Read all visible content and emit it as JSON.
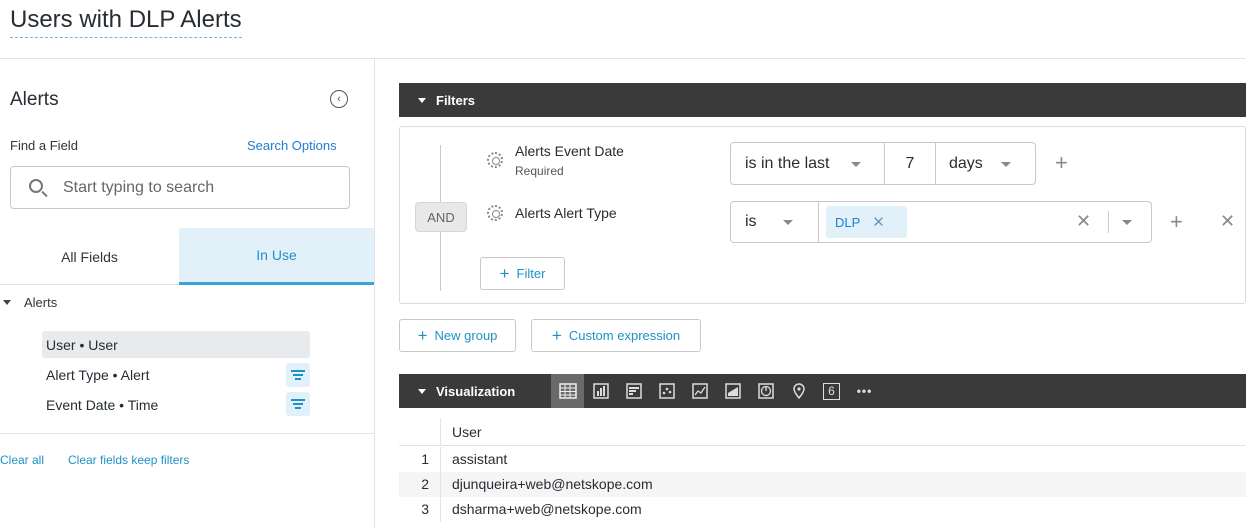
{
  "header": {
    "title": "Users with DLP Alerts"
  },
  "sidebar": {
    "title": "Alerts",
    "find_label": "Find a Field",
    "search_options": "Search Options",
    "search_placeholder": "Start typing to search",
    "tabs": [
      {
        "label": "All Fields"
      },
      {
        "label": "In Use"
      }
    ],
    "group": "Alerts",
    "fields": [
      {
        "label": "User • User"
      },
      {
        "label": "Alert Type • Alert"
      },
      {
        "label": "Event Date • Time"
      }
    ],
    "clear_all": "Clear all",
    "clear_keep": "Clear fields keep filters"
  },
  "filters": {
    "title": "Filters",
    "and_label": "AND",
    "rows": [
      {
        "field": "Alerts Event Date",
        "sub": "Required",
        "operator": "is in the last",
        "value": "7",
        "unit": "days"
      },
      {
        "field": "Alerts Alert Type",
        "operator": "is",
        "chip": "DLP"
      }
    ],
    "add_filter": "Filter",
    "new_group": "New group",
    "custom_expression": "Custom expression"
  },
  "visualization": {
    "title": "Visualization",
    "icons": [
      "table-icon",
      "column-chart-icon",
      "bar-chart-icon",
      "scatter-icon",
      "line-chart-icon",
      "area-chart-icon",
      "pie-chart-icon",
      "map-pin-icon",
      "single-value-icon",
      "more-icon"
    ],
    "single_value_label": "6",
    "more_label": "•••",
    "table": {
      "header": "User",
      "rows": [
        {
          "num": "1",
          "user": "assistant"
        },
        {
          "num": "2",
          "user": "djunqueira+web@netskope.com"
        },
        {
          "num": "3",
          "user": "dsharma+web@netskope.com"
        }
      ]
    }
  },
  "colors": {
    "accent": "#1f91c9",
    "bar": "#3a3a3a",
    "chip_bg": "#e2f1f9"
  }
}
